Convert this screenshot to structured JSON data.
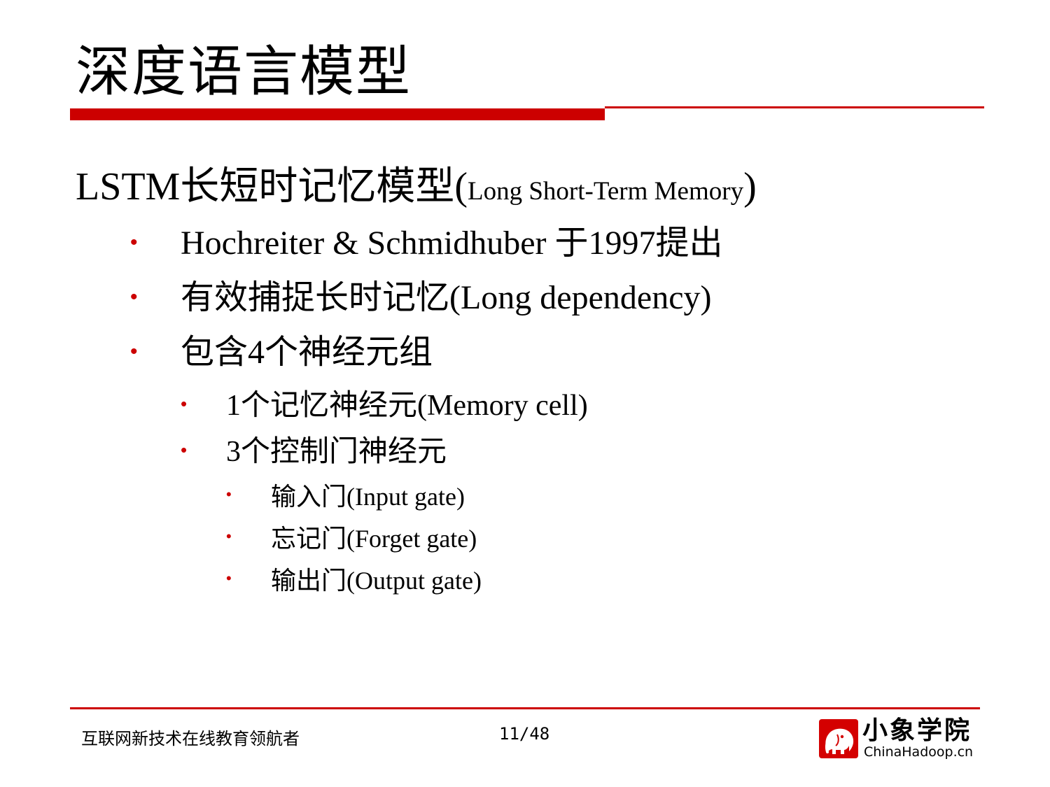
{
  "slide": {
    "title": "深度语言模型",
    "heading": {
      "main": "LSTM长短时记忆模型(",
      "small": "Long Short-Term Memory",
      "close": ")"
    },
    "bullet_symbol": "•",
    "bullets": [
      {
        "level": 1,
        "text": "Hochreiter & Schmidhuber 于1997提出"
      },
      {
        "level": 1,
        "text": "有效捕捉长时记忆(Long dependency)"
      },
      {
        "level": 1,
        "text": "包含4个神经元组"
      },
      {
        "level": 2,
        "text": "1个记忆神经元(Memory cell)"
      },
      {
        "level": 2,
        "text": "3个控制门神经元"
      },
      {
        "level": 3,
        "text": "输入门(Input gate)"
      },
      {
        "level": 3,
        "text": "忘记门(Forget gate)"
      },
      {
        "level": 3,
        "text": "输出门(Output gate)"
      }
    ]
  },
  "footer": {
    "slogan": "互联网新技术在线教育领航者",
    "page_number": "11/48",
    "logo_name": "小象学院",
    "logo_site": "ChinaHadoop.cn"
  },
  "colors": {
    "accent": "#cc0000",
    "text": "#000000",
    "background": "#ffffff"
  },
  "icons": {
    "logo_mark": "elephant-logo-icon"
  }
}
